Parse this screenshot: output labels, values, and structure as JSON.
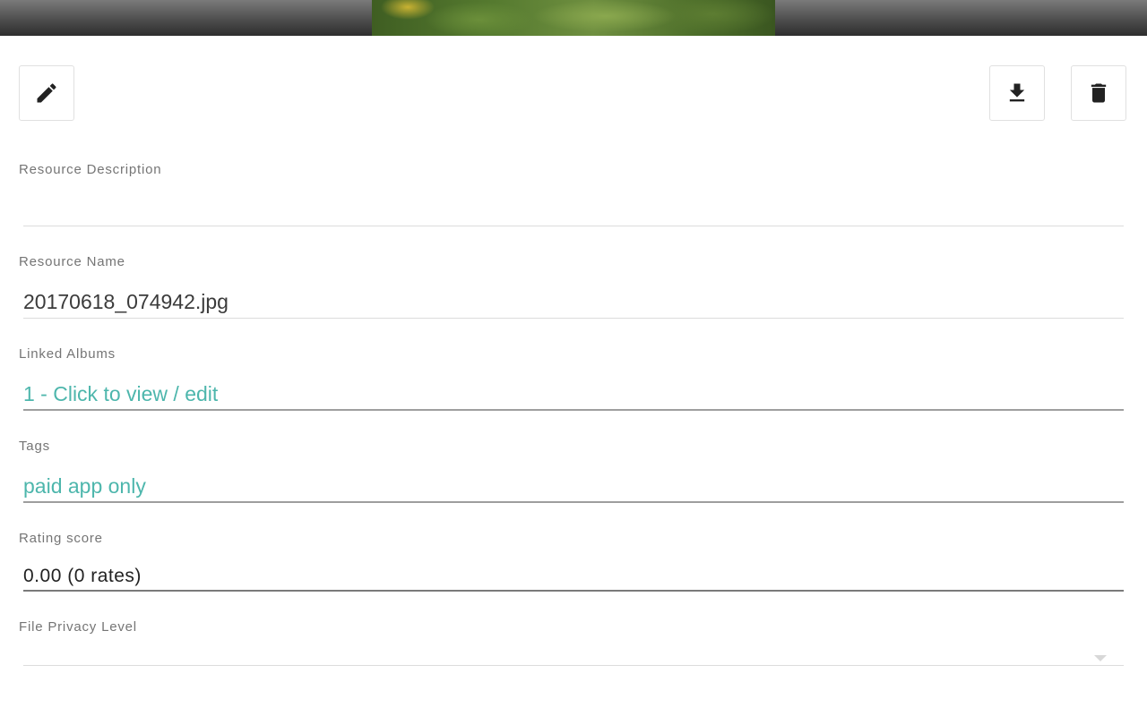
{
  "toolbar": {
    "edit_icon": "pencil-icon",
    "download_icon": "download-icon",
    "delete_icon": "trash-icon"
  },
  "fields": {
    "description": {
      "label": "Resource Description",
      "value": ""
    },
    "name": {
      "label": "Resource Name",
      "value": "20170618_074942.jpg"
    },
    "albums": {
      "label": "Linked Albums",
      "value": "1 - Click to view / edit"
    },
    "tags": {
      "label": "Tags",
      "value": "paid app only"
    },
    "rating": {
      "label": "Rating score",
      "value": "0.00 (0 rates)"
    },
    "privacy": {
      "label": "File Privacy Level",
      "value": ""
    }
  },
  "colors": {
    "accent": "#4db6ac",
    "label": "#757575"
  }
}
